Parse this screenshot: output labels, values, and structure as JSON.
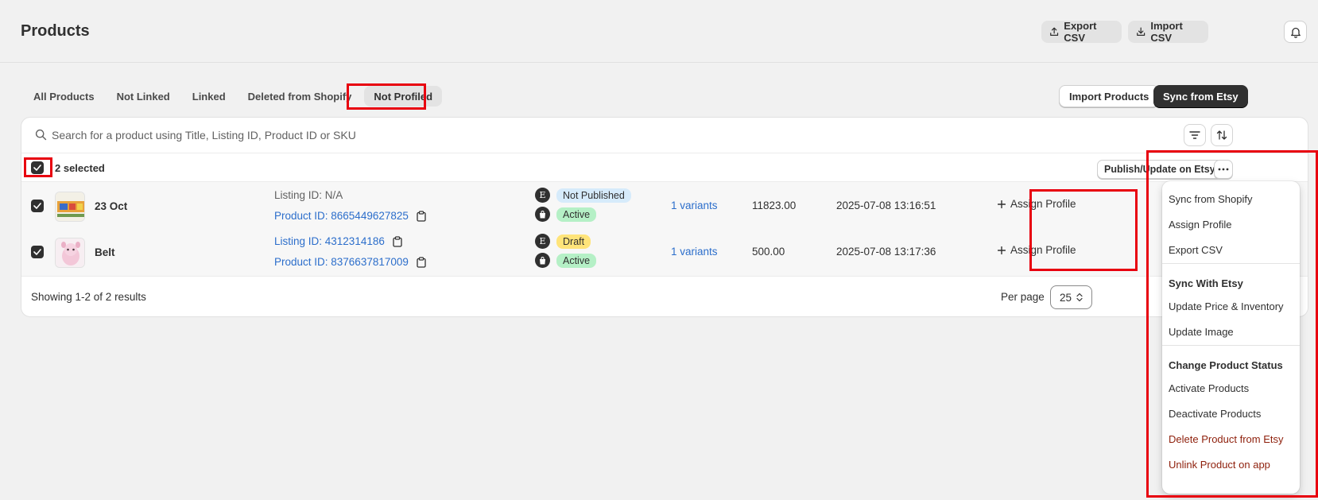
{
  "header": {
    "title": "Products",
    "export_label": "Export CSV",
    "import_label": "Import CSV"
  },
  "tabs": [
    {
      "label": "All Products"
    },
    {
      "label": "Not Linked"
    },
    {
      "label": "Linked"
    },
    {
      "label": "Deleted from Shopify"
    },
    {
      "label": "Not Profiled",
      "active": true
    }
  ],
  "actions": {
    "import_products": "Import Products",
    "sync_from_etsy": "Sync from Etsy"
  },
  "search": {
    "placeholder": "Search for a product using Title, Listing ID, Product ID or SKU"
  },
  "bulk": {
    "selected_label": "2 selected",
    "publish_label": "Publish/Update on Etsy"
  },
  "products": [
    {
      "name": "23 Oct",
      "listing_id": "Listing ID: N/A",
      "product_id": "Product ID: 8665449627825",
      "etsy_status": "Not Published",
      "shopify_status": "Active",
      "variants": "1 variants",
      "price": "11823.00",
      "date": "2025-07-08 13:16:51",
      "assign_label": "Assign Profile"
    },
    {
      "name": "Belt",
      "listing_id": "Listing ID: 4312314186",
      "product_id": "Product ID: 8376637817009",
      "etsy_status": "Draft",
      "shopify_status": "Active",
      "variants": "1 variants",
      "price": "500.00",
      "date": "2025-07-08 13:17:36",
      "assign_label": "Assign Profile"
    }
  ],
  "footer": {
    "showing": "Showing 1-2 of 2 results",
    "per_page_label": "Per page",
    "per_page_value": "25"
  },
  "menu": {
    "sync_from_shopify": "Sync from Shopify",
    "assign_profile": "Assign Profile",
    "export_csv": "Export CSV",
    "sync_with_etsy_heading": "Sync With Etsy",
    "update_price_inventory": "Update Price & Inventory",
    "update_image": "Update Image",
    "change_status_heading": "Change Product Status",
    "activate_products": "Activate Products",
    "deactivate_products": "Deactivate Products",
    "delete_from_etsy": "Delete Product from Etsy",
    "unlink_product": "Unlink Product on app"
  },
  "icons": {
    "etsy_letter": "E",
    "export": "upload-icon",
    "import": "download-icon",
    "bell": "bell-icon",
    "search": "search-icon",
    "filter": "filter-icon",
    "sort": "sort-icon",
    "more": "more-horizontal-icon",
    "copy": "clipboard-icon",
    "plus": "plus-icon",
    "shopify": "shopping-bag-icon"
  },
  "colors": {
    "highlight": "#e8000f",
    "link": "#2c6ecb",
    "danger": "#8e1f0b"
  }
}
